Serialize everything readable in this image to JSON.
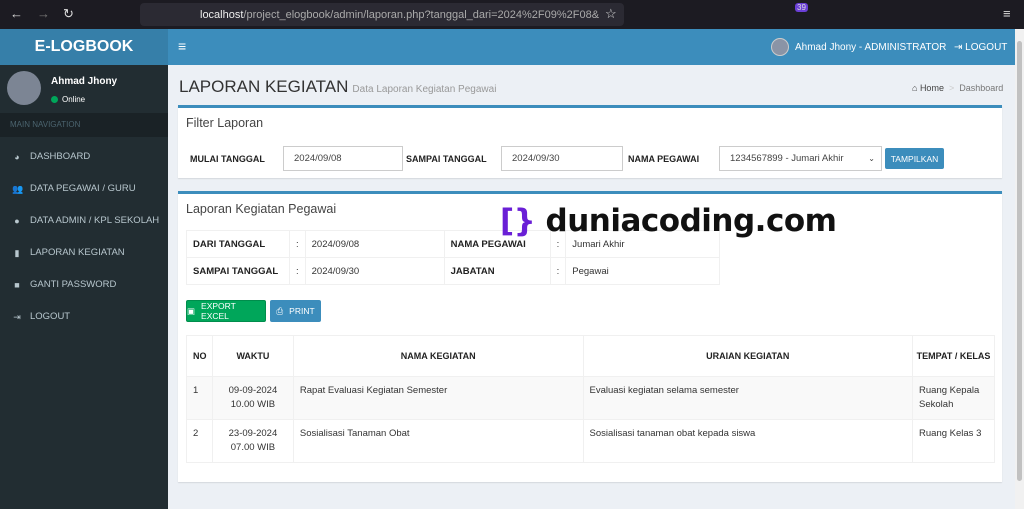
{
  "browser": {
    "url_host": "localhost",
    "url_path": "/project_elogbook/admin/laporan.php?tanggal_dari=2024%2F09%2F08&",
    "badge": "39"
  },
  "header": {
    "brand": "E-LOGBOOK",
    "user": "Ahmad Jhony - ADMINISTRATOR",
    "logout": "LOGOUT"
  },
  "sidebar": {
    "user_name": "Ahmad Jhony",
    "status": "Online",
    "nav_header": "MAIN NAVIGATION",
    "items": [
      {
        "label": "DASHBOARD",
        "icon": "dashboard-icon"
      },
      {
        "label": "DATA PEGAWAI / GURU",
        "icon": "users-icon"
      },
      {
        "label": "DATA ADMIN / KPL SEKOLAH",
        "icon": "user-icon"
      },
      {
        "label": "LAPORAN KEGIATAN",
        "icon": "file-icon"
      },
      {
        "label": "GANTI PASSWORD",
        "icon": "lock-icon"
      },
      {
        "label": "LOGOUT",
        "icon": "sign-out-icon"
      }
    ]
  },
  "page": {
    "title": "LAPORAN KEGIATAN",
    "subtitle": "Data Laporan Kegiatan Pegawai",
    "breadcrumb": [
      "Home",
      "Dashboard"
    ]
  },
  "filter": {
    "title": "Filter Laporan",
    "mulai_label": "MULAI TANGGAL",
    "mulai_value": "2024/09/08",
    "sampai_label": "SAMPAI TANGGAL",
    "sampai_value": "2024/09/30",
    "pegawai_label": "NAMA PEGAWAI",
    "pegawai_value": "1234567899 - Jumari Akhir",
    "submit": "TAMPILKAN"
  },
  "report": {
    "title": "Laporan Kegiatan Pegawai",
    "dari_label": "DARI TANGGAL",
    "dari_value": "2024/09/08",
    "sampai_label": "SAMPAI TANGGAL",
    "sampai_value": "2024/09/30",
    "nama_label": "NAMA PEGAWAI",
    "nama_value": "Jumari Akhir",
    "jabatan_label": "JABATAN",
    "jabatan_value": "Pegawai",
    "colon": ":",
    "export": "EXPORT EXCEL",
    "print": "PRINT",
    "columns": [
      "NO",
      "WAKTU",
      "NAMA KEGIATAN",
      "URAIAN KEGIATAN",
      "TEMPAT / KELAS"
    ],
    "rows": [
      {
        "no": "1",
        "tanggal": "09-09-2024",
        "jam": "10.00 WIB",
        "nama": "Rapat Evaluasi Kegiatan Semester",
        "uraian": "Evaluasi kegiatan selama semester",
        "tempat": "Ruang Kepala Sekolah"
      },
      {
        "no": "2",
        "tanggal": "23-09-2024",
        "jam": "07.00 WIB",
        "nama": "Sosialisasi Tanaman Obat",
        "uraian": "Sosialisasi tanaman obat kepada siswa",
        "tempat": "Ruang Kelas 3"
      }
    ]
  },
  "watermark": "duniacoding.com",
  "colors": {
    "primary": "#3c8dbc",
    "sidebar": "#222d32",
    "success": "#00a65a"
  }
}
